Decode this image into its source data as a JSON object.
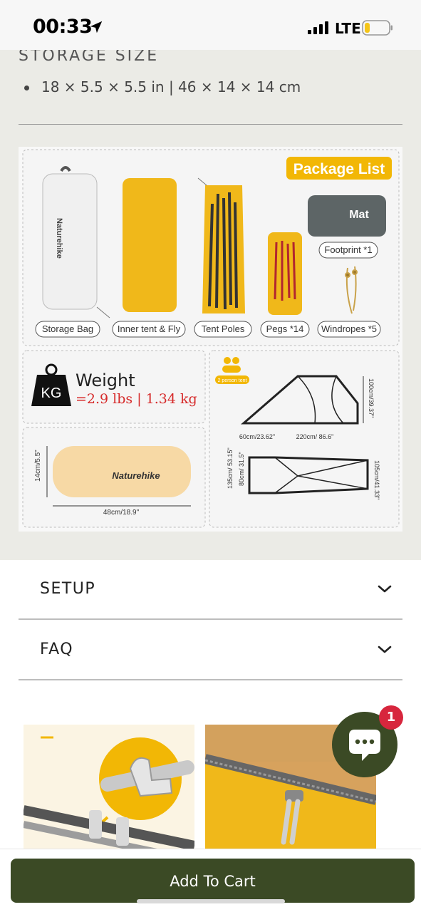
{
  "status_bar": {
    "time": "00:33",
    "network": "LTE",
    "location_icon": "location-arrow-icon",
    "battery_color": "#f5c518"
  },
  "storage": {
    "title": "STORAGE SIZE",
    "items": [
      "18 × 5.5 × 5.5 in | 46 × 14 × 14 cm"
    ]
  },
  "package_image": {
    "header": "Package List",
    "items": [
      "Storage Bag",
      "Inner tent & Fly",
      "Tent Poles",
      "Pegs *14",
      "Windropes *5",
      "Footprint *1"
    ],
    "mat_label": "Mat",
    "bag_brand": "Naturehike",
    "weight_unit_icon": "KG",
    "weight_label": "Weight",
    "weight_value": "=2.9 lbs | 1.34 kg",
    "tent_badge": "2 person tent",
    "dims_side": [
      "60cm/23.62\"",
      "220cm/ 86.6\"",
      "100cm/39.37\""
    ],
    "dims_floor": [
      "135cm/ 53.15\"",
      "80cm/ 31.5\"",
      "105cm/41.33\""
    ],
    "dims_bag": [
      "14cm/5.5\"",
      "48cm/18.9\""
    ],
    "accent_color": "#f2b705"
  },
  "accordions": [
    {
      "label": "SETUP",
      "icon": "chevron-down-icon"
    },
    {
      "label": "FAQ",
      "icon": "chevron-down-icon"
    }
  ],
  "chat": {
    "badge_count": "1",
    "icon": "chat-bubble-icon",
    "color": "#3b4a25"
  },
  "cart": {
    "label": "Add To Cart",
    "color": "#3b4a25"
  }
}
